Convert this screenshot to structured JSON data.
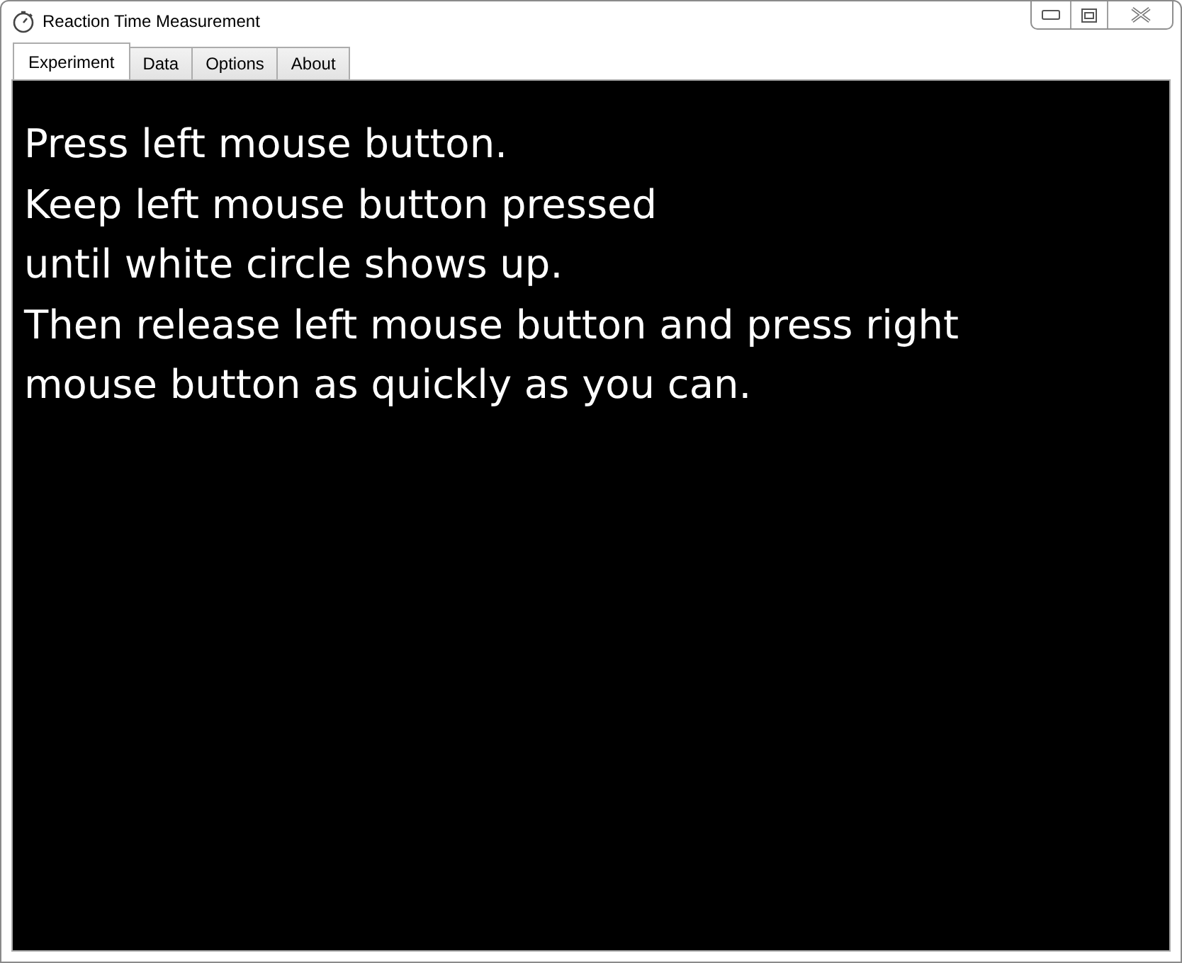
{
  "window": {
    "title": "Reaction Time Measurement"
  },
  "tabs": [
    {
      "label": "Experiment",
      "selected": true
    },
    {
      "label": "Data",
      "selected": false
    },
    {
      "label": "Options",
      "selected": false
    },
    {
      "label": "About",
      "selected": false
    }
  ],
  "instructions": "Press left mouse button.\nKeep left mouse button pressed\nuntil white circle shows up.\nThen release left mouse button and press right\nmouse button as quickly as you can."
}
